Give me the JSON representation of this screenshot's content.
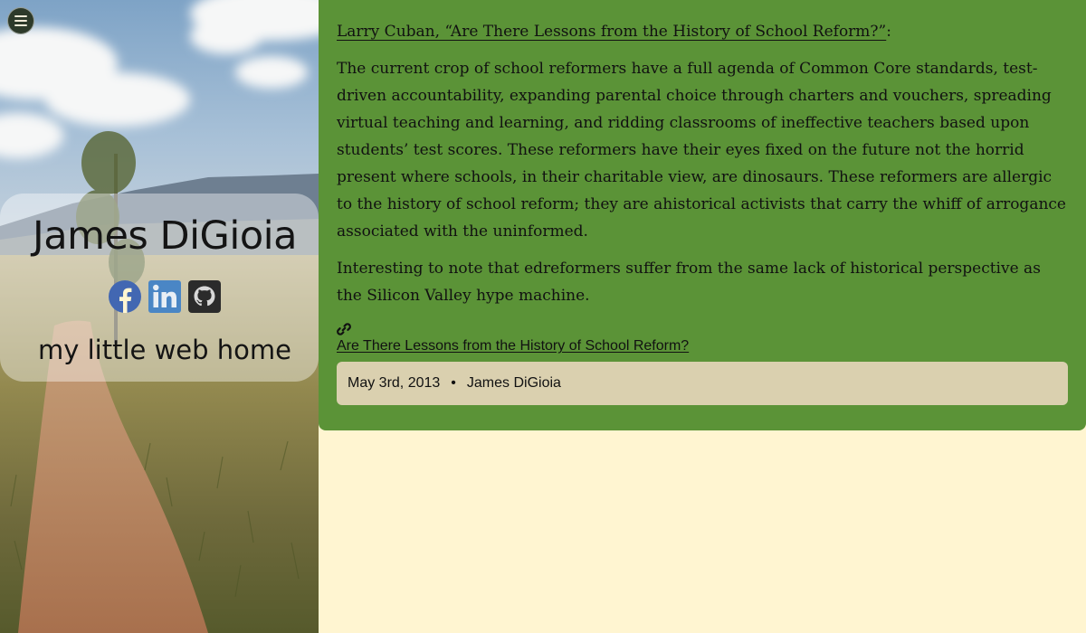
{
  "sidebar": {
    "menu_icon": "hamburger-menu-icon",
    "profile": {
      "name": "James DiGioia",
      "tagline": "my little web home",
      "social": [
        {
          "icon": "facebook-icon",
          "color": "#4267b2"
        },
        {
          "icon": "linkedin-icon",
          "color": "#4a86c5"
        },
        {
          "icon": "github-icon",
          "color": "#2b2b2b"
        }
      ]
    }
  },
  "post": {
    "source_link": "Larry Cuban, “Are There Lessons from the History of School Reform?”",
    "source_suffix": ":",
    "quote": "The current crop of school reformers have a full agenda of Common Core standards, test-driven accountability, expanding parental choice through charters and vouchers, spreading virtual teaching and learning, and ridding classrooms of ineffective teachers based upon students’ test scores. These reformers have their eyes fixed on the future not the horrid present where schools, in their charitable view, are dinosaurs. These reformers are allergic to the history of school reform; they are ahistorical activists that carry the whiff of arrogance associated with the uninformed.",
    "commentary": "Interesting to note that edreformers suffer from the same lack of historical perspective as the Silicon Valley hype machine.",
    "permalink_icon": "link-icon",
    "permalink_text": "Are There Lessons from the History of School Reform?",
    "meta": {
      "date": "May 3rd, 2013",
      "separator": "•",
      "author": "James DiGioia"
    }
  },
  "colors": {
    "page_background": "#fff5d1",
    "post_background": "#5b9337",
    "meta_background": "#dad0af"
  }
}
